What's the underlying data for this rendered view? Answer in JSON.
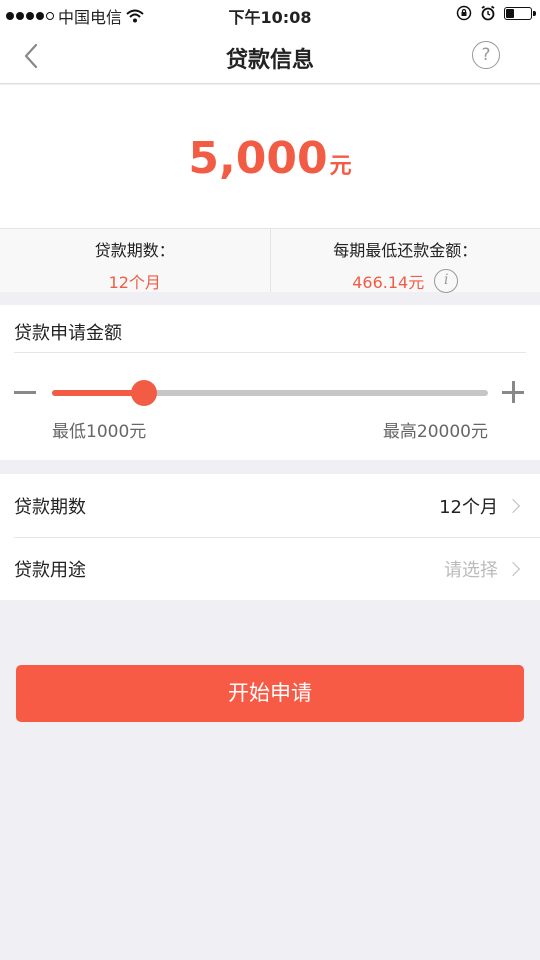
{
  "status_bar": {
    "carrier": "中国电信",
    "time": "下午10:08",
    "battery_level": 0.35
  },
  "nav": {
    "title": "贷款信息",
    "help_icon": "?"
  },
  "loan": {
    "amount": "5,000",
    "unit": "元"
  },
  "info": {
    "term_label": "贷款期数：",
    "term_value": "12个月",
    "payment_label": "每期最低还款金额：",
    "payment_value": "466.14元",
    "info_icon": "i"
  },
  "slider": {
    "title": "贷款申请金额",
    "min_label": "最低1000元",
    "max_label": "最高20000元",
    "min": 1000,
    "max": 20000,
    "value": 5000
  },
  "options": {
    "term_label": "贷款期数",
    "term_value": "12个月",
    "purpose_label": "贷款用途",
    "purpose_placeholder": "请选择"
  },
  "actions": {
    "submit_label": "开始申请"
  },
  "colors": {
    "accent": "#f25c45"
  }
}
